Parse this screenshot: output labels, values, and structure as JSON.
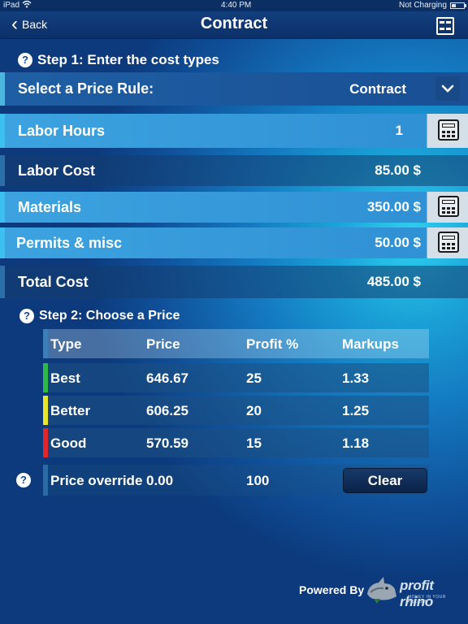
{
  "status": {
    "carrier": "iPad",
    "time": "4:40 PM",
    "battery": "Not Charging"
  },
  "nav": {
    "back": "Back",
    "title": "Contract"
  },
  "step1": {
    "title": "Step 1: Enter the cost types"
  },
  "rows": {
    "price_rule": {
      "label": "Select a Price Rule:",
      "value": "Contract"
    },
    "labor_hours": {
      "label": "Labor Hours",
      "value": "1"
    },
    "labor_cost": {
      "label": "Labor Cost",
      "value": "85.00 $"
    },
    "materials": {
      "label": "Materials",
      "value": "350.00 $"
    },
    "permits": {
      "label": "Permits & misc",
      "value": "50.00 $"
    },
    "total": {
      "label": "Total Cost",
      "value": "485.00 $"
    }
  },
  "step2": {
    "title": "Step 2: Choose a Price"
  },
  "table": {
    "headers": [
      "Type",
      "Price",
      "Profit %",
      "Markups"
    ],
    "rows": [
      {
        "type": "Best",
        "price": "646.67",
        "profit": "25",
        "markup": "1.33",
        "color": "#2fb84a"
      },
      {
        "type": "Better",
        "price": "606.25",
        "profit": "20",
        "markup": "1.25",
        "color": "#e8e52a"
      },
      {
        "type": "Good",
        "price": "570.59",
        "profit": "15",
        "markup": "1.18",
        "color": "#e0262a"
      }
    ],
    "override": {
      "label": "Price override",
      "price": "0.00",
      "profit": "100",
      "clear": "Clear"
    }
  },
  "footer": {
    "powered": "Powered By",
    "brand": "profit rhino",
    "tagline": "MONEY IN YOUR POCKET"
  },
  "help_icon": "?"
}
